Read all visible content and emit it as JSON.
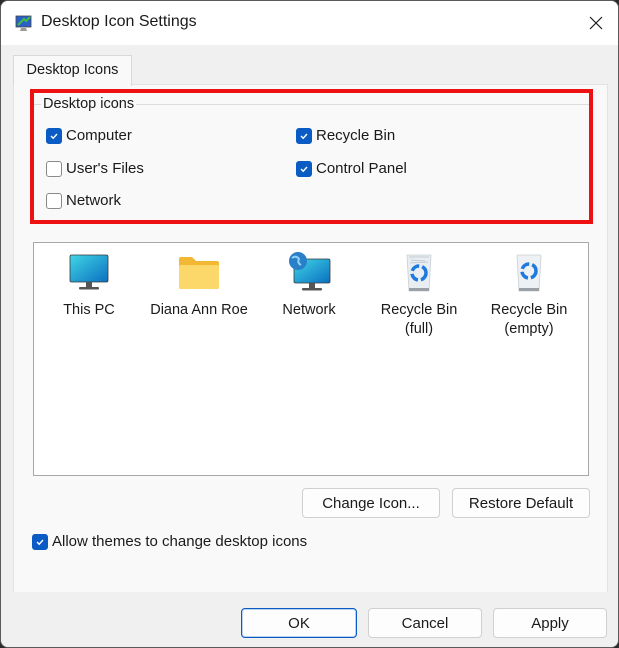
{
  "window": {
    "title": "Desktop Icon Settings",
    "app_icon": "desktop-settings-icon",
    "close_icon": "close-icon"
  },
  "tabs": [
    {
      "label": "Desktop Icons",
      "active": true
    }
  ],
  "desktop_icons_group": {
    "label": "Desktop icons",
    "checkboxes": [
      {
        "label": "Computer",
        "checked": true
      },
      {
        "label": "Recycle Bin",
        "checked": true
      },
      {
        "label": "User's Files",
        "checked": false
      },
      {
        "label": "Control Panel",
        "checked": true
      },
      {
        "label": "Network",
        "checked": false
      }
    ],
    "highlight_color": "#ee1111"
  },
  "icon_list": [
    {
      "label": "This PC",
      "icon": "monitor-icon"
    },
    {
      "label": "Diana Ann Roe",
      "icon": "folder-icon"
    },
    {
      "label": "Network",
      "icon": "network-icon"
    },
    {
      "label": "Recycle Bin (full)",
      "icon": "recycle-bin-full-icon"
    },
    {
      "label": "Recycle Bin (empty)",
      "icon": "recycle-bin-empty-icon"
    }
  ],
  "buttons": {
    "change_icon": "Change Icon...",
    "restore_default": "Restore Default",
    "ok": "OK",
    "cancel": "Cancel",
    "apply": "Apply"
  },
  "allow_themes": {
    "label": "Allow themes to change desktop icons",
    "checked": true
  },
  "colors": {
    "accent": "#0a5bc4"
  }
}
